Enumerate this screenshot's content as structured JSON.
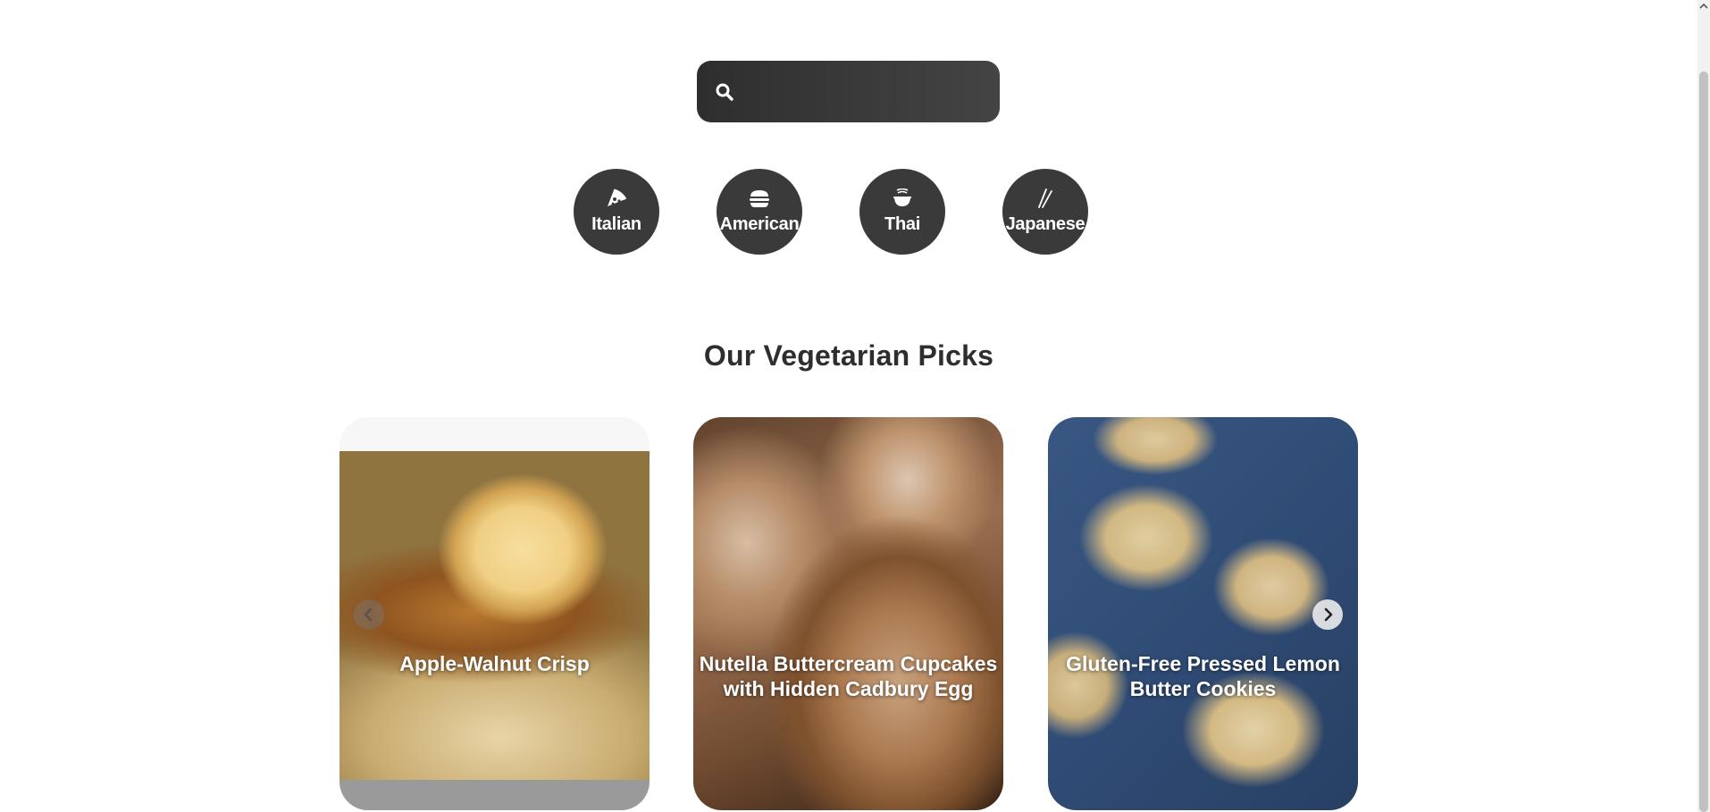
{
  "search": {
    "placeholder": "",
    "value": "",
    "icon": "search-icon"
  },
  "cuisines": [
    {
      "label": "Italian",
      "icon": "pizza-icon"
    },
    {
      "label": "American",
      "icon": "burger-icon"
    },
    {
      "label": "Thai",
      "icon": "noodle-bowl-icon"
    },
    {
      "label": "Japanese",
      "icon": "chopsticks-icon"
    }
  ],
  "section": {
    "title": "Our Vegetarian Picks"
  },
  "cards": [
    {
      "title": "Apple-Walnut Crisp"
    },
    {
      "title": "Nutella Buttercream Cupcakes with Hidden Cadbury Egg"
    },
    {
      "title": "Gluten-Free Pressed Lemon Butter Cookies"
    }
  ],
  "colors": {
    "button_bg": "#3a3a3a",
    "search_bg": "#3a3a3a",
    "heading": "#2e2e2e",
    "text_on_dark": "#ffffff"
  }
}
